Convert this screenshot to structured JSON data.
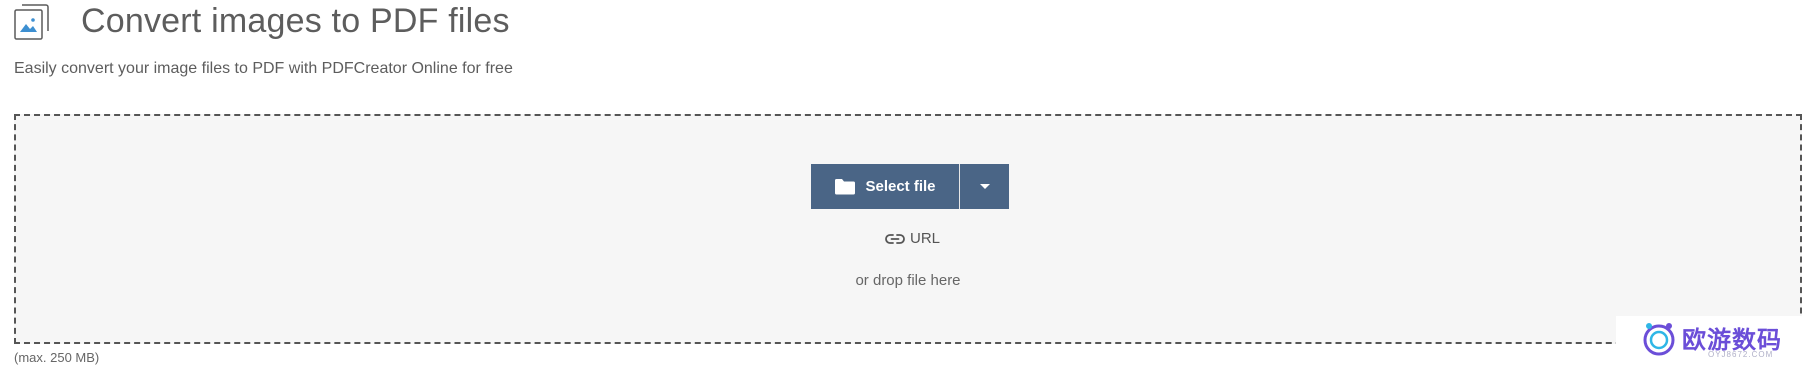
{
  "header": {
    "title": "Convert images to PDF files",
    "subtitle": "Easily convert your image files to PDF with PDFCreator Online for free",
    "icon": "image-file-icon"
  },
  "dropzone": {
    "select_label": "Select file",
    "select_icon": "folder-icon",
    "dropdown_icon": "caret-down-icon",
    "url_label": "URL",
    "url_icon": "link-icon",
    "drop_text": "or drop file here",
    "max_size": "(max. 250 MB)"
  },
  "watermark": {
    "text": "欧游数码",
    "sub": "OYJ8672.COM"
  },
  "colors": {
    "button": "#4a6586",
    "dropzone_bg": "#f6f6f6",
    "icon_accent": "#3d8fd1",
    "watermark": "#6b4ed8"
  }
}
